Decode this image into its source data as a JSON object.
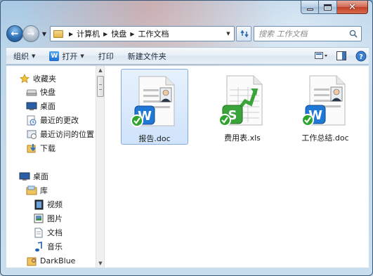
{
  "window": {
    "caption_buttons": {
      "minimize": "minimize",
      "maximize": "maximize",
      "close": "✕"
    }
  },
  "nav": {
    "back": "←",
    "forward": "→",
    "breadcrumbs": [
      "计算机",
      "快盘",
      "工作文档"
    ],
    "search_placeholder": "搜索 工作文档"
  },
  "toolbar": {
    "organize_label": "组织",
    "open_label": "打开",
    "open_badge": "W",
    "print_label": "打印",
    "new_folder_label": "新建文件夹"
  },
  "sidebar": {
    "favorites": [
      {
        "label": "收藏夹",
        "icon": "star-icon"
      },
      {
        "label": "快盘",
        "icon": "drive-icon"
      },
      {
        "label": "桌面",
        "icon": "desktop-icon"
      },
      {
        "label": "最近的更改",
        "icon": "recent-icon"
      },
      {
        "label": "最近访问的位置",
        "icon": "places-icon"
      },
      {
        "label": "下载",
        "icon": "download-icon"
      }
    ],
    "tree": [
      {
        "label": "桌面",
        "icon": "desktop-icon"
      },
      {
        "label": "库",
        "icon": "library-icon"
      },
      {
        "label": "视频",
        "icon": "video-icon"
      },
      {
        "label": "图片",
        "icon": "pictures-icon"
      },
      {
        "label": "文档",
        "icon": "documents-icon"
      },
      {
        "label": "音乐",
        "icon": "music-icon"
      },
      {
        "label": "DarkBlue",
        "icon": "user-folder-icon"
      }
    ]
  },
  "files": [
    {
      "name": "报告.doc",
      "type": "word",
      "badge": "W",
      "selected": true
    },
    {
      "name": "费用表.xls",
      "type": "excel",
      "badge": "S",
      "selected": false
    },
    {
      "name": "工作总结.doc",
      "type": "word",
      "badge": "W",
      "selected": false
    }
  ],
  "colors": {
    "word_badge": "#1f78d6",
    "excel_badge": "#3aa43a",
    "sync_check": "#2ea32e",
    "selection": "#cfe3fb"
  }
}
